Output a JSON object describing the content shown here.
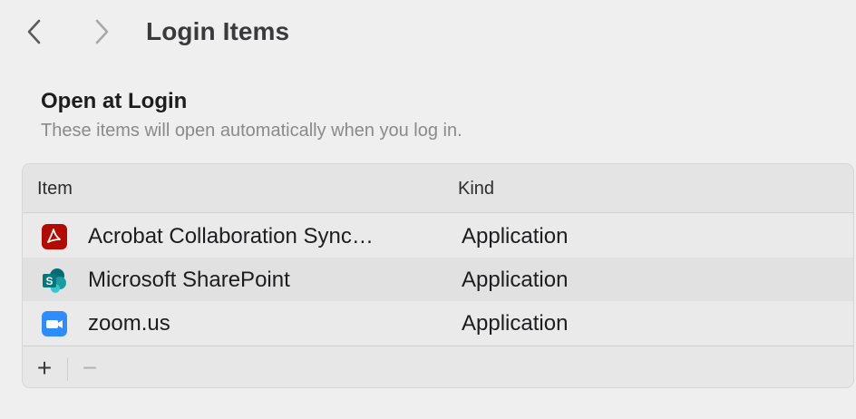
{
  "toolbar": {
    "title": "Login Items",
    "back_icon": "chevron-left-icon",
    "forward_icon": "chevron-right-icon"
  },
  "section": {
    "title": "Open at Login",
    "subtitle": "These items will open automatically when you log in."
  },
  "table": {
    "columns": [
      "Item",
      "Kind"
    ],
    "rows": [
      {
        "name": "Acrobat Collaboration Sync…",
        "kind": "Application",
        "icon": "acrobat-icon"
      },
      {
        "name": "Microsoft SharePoint",
        "kind": "Application",
        "icon": "sharepoint-icon"
      },
      {
        "name": "zoom.us",
        "kind": "Application",
        "icon": "zoom-icon"
      }
    ],
    "add_label": "+",
    "remove_label": "−"
  },
  "colors": {
    "acrobat": "#b30b00",
    "sharepoint": "#03787c",
    "zoom": "#2d8cff"
  }
}
